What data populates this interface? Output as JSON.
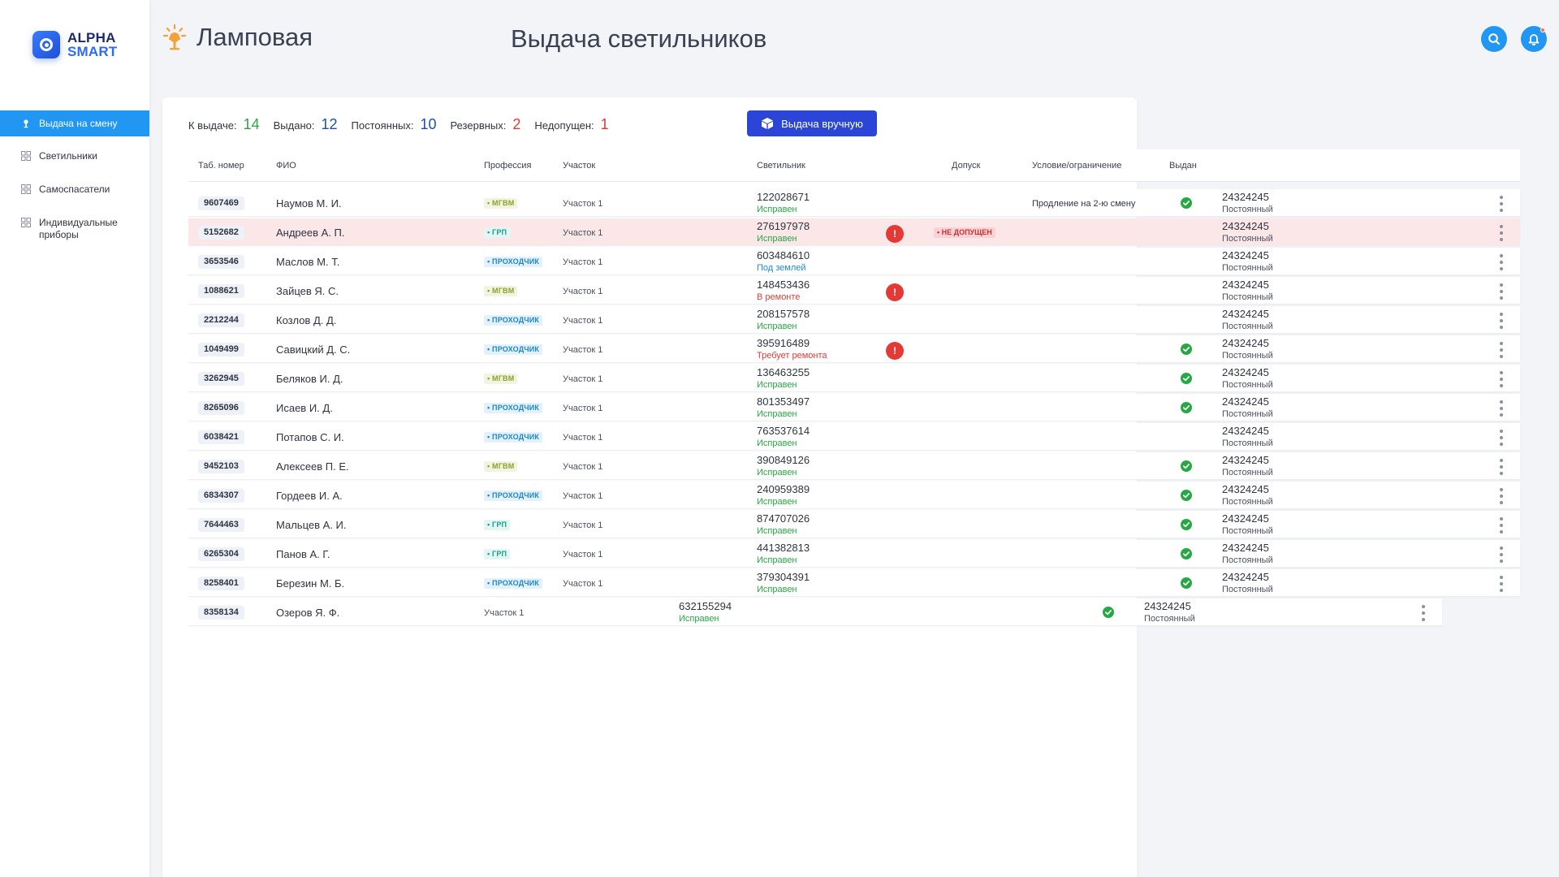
{
  "logo": {
    "line1": "ALPHA",
    "line2": "SMART"
  },
  "sidebar": {
    "items": [
      {
        "label": "Выдача на смену"
      },
      {
        "label": "Светильники"
      },
      {
        "label": "Самоспасатели"
      },
      {
        "label": "Индивидуальные приборы"
      }
    ]
  },
  "header": {
    "title": "Ламповая",
    "section": "Выдача светильников"
  },
  "stats": {
    "to_issue_label": "К выдаче:",
    "to_issue": "14",
    "issued_label": "Выдано:",
    "issued": "12",
    "permanent_label": "Постоянных:",
    "permanent": "10",
    "reserve_label": "Резервных:",
    "reserve": "2",
    "denied_label": "Недопущен:",
    "denied": "1"
  },
  "manual_button": "Выдача вручную",
  "columns": {
    "tab": "Таб. номер",
    "fio": "ФИО",
    "prof": "Профессия",
    "uch": "Участок",
    "lamp": "Светильник",
    "access": "Допуск",
    "cond": "Условие/ограничение",
    "issued": "Выдан"
  },
  "rows": [
    {
      "tab": "9607469",
      "fio": "Наумов М. И.",
      "prof": "• МГВМ",
      "uch": "Участок 1",
      "lamp": "122028671",
      "lamp_status": "Исправен",
      "cond": "Продление на 2-ю смену",
      "code": "24324245",
      "code_type": "Постоянный"
    },
    {
      "tab": "5152682",
      "fio": "Андреев А. П.",
      "prof": "• ГРП",
      "uch": "Участок 1",
      "lamp": "276197978",
      "lamp_status": "Исправен",
      "warn": "!",
      "access": "• НЕ ДОПУЩЕН",
      "code": "24324245",
      "code_type": "Постоянный"
    },
    {
      "tab": "3653546",
      "fio": "Маслов М. Т.",
      "prof": "• ПРОХОДЧИК",
      "uch": "Участок 1",
      "lamp": "603484610",
      "lamp_status": "Под землей",
      "code": "24324245",
      "code_type": "Постоянный"
    },
    {
      "tab": "1088621",
      "fio": "Зайцев Я. С.",
      "prof": "• МГВМ",
      "uch": "Участок 1",
      "lamp": "148453436",
      "lamp_status": "В ремонте",
      "warn": "!",
      "code": "24324245",
      "code_type": "Постоянный"
    },
    {
      "tab": "2212244",
      "fio": "Козлов Д. Д.",
      "prof": "• ПРОХОДЧИК",
      "uch": "Участок 1",
      "lamp": "208157578",
      "lamp_status": "Исправен",
      "code": "24324245",
      "code_type": "Постоянный"
    },
    {
      "tab": "1049499",
      "fio": "Савицкий Д. С.",
      "prof": "• ПРОХОДЧИК",
      "uch": "Участок 1",
      "lamp": "395916489",
      "lamp_status": "Требует ремонта",
      "warn": "!",
      "code": "24324245",
      "code_type": "Постоянный"
    },
    {
      "tab": "3262945",
      "fio": "Беляков И. Д.",
      "prof": "• МГВМ",
      "uch": "Участок 1",
      "lamp": "136463255",
      "lamp_status": "Исправен",
      "code": "24324245",
      "code_type": "Постоянный"
    },
    {
      "tab": "8265096",
      "fio": "Исаев И. Д.",
      "prof": "• ПРОХОДЧИК",
      "uch": "Участок 1",
      "lamp": "801353497",
      "lamp_status": "Исправен",
      "code": "24324245",
      "code_type": "Постоянный"
    },
    {
      "tab": "6038421",
      "fio": "Потапов С. И.",
      "prof": "• ПРОХОДЧИК",
      "uch": "Участок 1",
      "lamp": "763537614",
      "lamp_status": "Исправен",
      "code": "24324245",
      "code_type": "Постоянный"
    },
    {
      "tab": "9452103",
      "fio": "Алексеев П. Е.",
      "prof": "• МГВМ",
      "uch": "Участок 1",
      "lamp": "390849126",
      "lamp_status": "Исправен",
      "code": "24324245",
      "code_type": "Постоянный"
    },
    {
      "tab": "6834307",
      "fio": "Гордеев И. А.",
      "prof": "• ПРОХОДЧИК",
      "uch": "Участок 1",
      "lamp": "240959389",
      "lamp_status": "Исправен",
      "code": "24324245",
      "code_type": "Постоянный"
    },
    {
      "tab": "7644463",
      "fio": "Мальцев А. И.",
      "prof": "• ГРП",
      "uch": "Участок 1",
      "lamp": "874707026",
      "lamp_status": "Исправен",
      "code": "24324245",
      "code_type": "Постоянный"
    },
    {
      "tab": "6265304",
      "fio": "Панов А. Г.",
      "prof": "• ГРП",
      "uch": "Участок 1",
      "lamp": "441382813",
      "lamp_status": "Исправен",
      "code": "24324245",
      "code_type": "Постоянный"
    },
    {
      "tab": "8258401",
      "fio": "Березин М. Б.",
      "prof": "• ПРОХОДЧИК",
      "uch": "Участок 1",
      "lamp": "379304391",
      "lamp_status": "Исправен",
      "code": "24324245",
      "code_type": "Постоянный"
    },
    {
      "tab": "8358134",
      "fio": "Озеров Я. Ф.",
      "uch": "Участок 1",
      "lamp": "632155294",
      "lamp_status": "Исправен",
      "code": "24324245",
      "code_type": "Постоянный"
    }
  ],
  "colors": {
    "accent": "#2196f3",
    "button": "#2b45d6",
    "ok": "#27a844",
    "error": "#e53935",
    "alert_row": "#fbe6e8"
  }
}
